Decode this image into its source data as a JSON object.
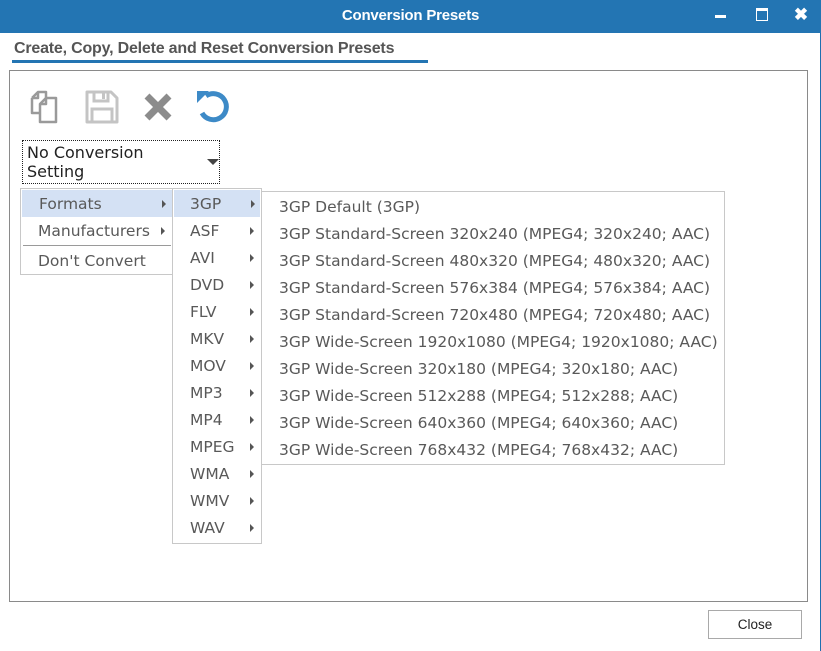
{
  "window": {
    "title": "Conversion Presets",
    "controls": {
      "minimize": "minimize",
      "maximize": "maximize",
      "close": "✖"
    }
  },
  "header": {
    "section_title": "Create, Copy, Delete and Reset Conversion Presets",
    "accent_color": "#2375b3"
  },
  "toolbar": {
    "buttons": [
      {
        "name": "copy",
        "icon": "copy-icon",
        "enabled": false
      },
      {
        "name": "save",
        "icon": "save-icon",
        "enabled": false
      },
      {
        "name": "delete",
        "icon": "delete-icon",
        "enabled": false
      },
      {
        "name": "reset",
        "icon": "reset-icon",
        "enabled": true
      }
    ]
  },
  "dropdown": {
    "selected": "No Conversion Setting"
  },
  "menu_level1": {
    "items": [
      {
        "label": "Formats",
        "has_submenu": true,
        "highlighted": true
      },
      {
        "label": "Manufacturers",
        "has_submenu": true,
        "highlighted": false
      },
      {
        "label": "Don't Convert",
        "has_submenu": false,
        "highlighted": false
      }
    ]
  },
  "menu_level2": {
    "items": [
      {
        "label": "3GP",
        "highlighted": true
      },
      {
        "label": "ASF"
      },
      {
        "label": "AVI"
      },
      {
        "label": "DVD"
      },
      {
        "label": "FLV"
      },
      {
        "label": "MKV"
      },
      {
        "label": "MOV"
      },
      {
        "label": "MP3"
      },
      {
        "label": "MP4"
      },
      {
        "label": "MPEG"
      },
      {
        "label": "WMA"
      },
      {
        "label": "WMV"
      },
      {
        "label": "WAV"
      }
    ]
  },
  "menu_level3": {
    "items": [
      {
        "label": "3GP Default (3GP)"
      },
      {
        "label": "3GP Standard-Screen 320x240 (MPEG4; 320x240; AAC)"
      },
      {
        "label": "3GP Standard-Screen 480x320 (MPEG4; 480x320; AAC)"
      },
      {
        "label": "3GP Standard-Screen 576x384 (MPEG4; 576x384; AAC)"
      },
      {
        "label": "3GP Standard-Screen 720x480 (MPEG4; 720x480; AAC)"
      },
      {
        "label": "3GP Wide-Screen 1920x1080 (MPEG4; 1920x1080; AAC)"
      },
      {
        "label": "3GP Wide-Screen 320x180 (MPEG4; 320x180; AAC)"
      },
      {
        "label": "3GP Wide-Screen 512x288 (MPEG4; 512x288; AAC)"
      },
      {
        "label": "3GP Wide-Screen 640x360 (MPEG4; 640x360; AAC)"
      },
      {
        "label": "3GP Wide-Screen 768x432 (MPEG4; 768x432; AAC)"
      }
    ]
  },
  "footer": {
    "close_label": "Close"
  }
}
